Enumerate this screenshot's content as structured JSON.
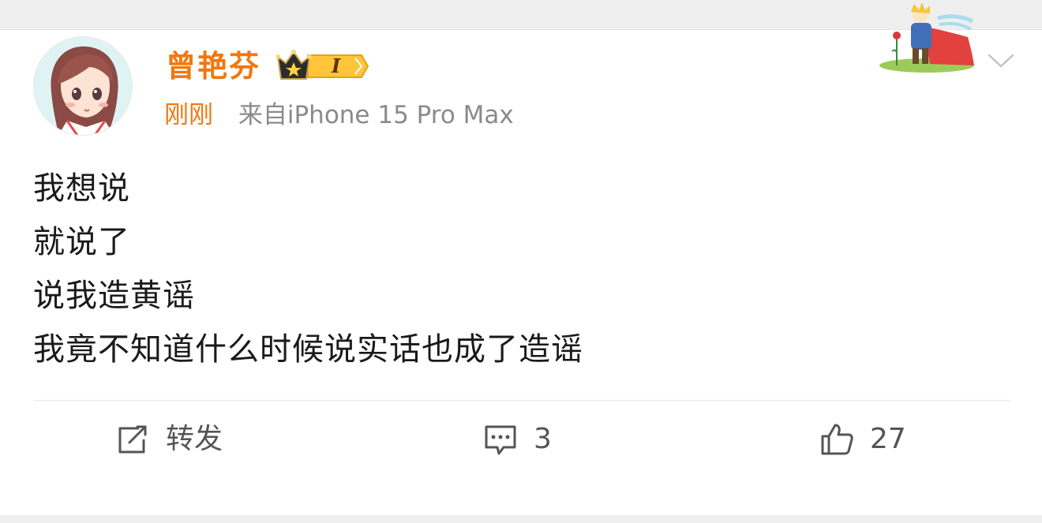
{
  "post": {
    "author": "曾艳芬",
    "vip_level": "I",
    "time": "刚刚",
    "source": "来自iPhone 15 Pro Max",
    "lines": [
      "我想说",
      "就说了",
      "说我造黄谣",
      "我竟不知道什么时候说实话也成了造谣"
    ]
  },
  "actions": {
    "repost_label": "转发",
    "comment_count": "3",
    "like_count": "27"
  },
  "colors": {
    "accent_orange": "#f2770e",
    "text_primary": "#1a1a1a",
    "text_secondary": "#8a8a8a"
  },
  "icons": [
    "avatar",
    "vip-crown-icon",
    "little-prince-sticker",
    "chevron-down-icon",
    "repost-icon",
    "comment-icon",
    "like-icon"
  ]
}
